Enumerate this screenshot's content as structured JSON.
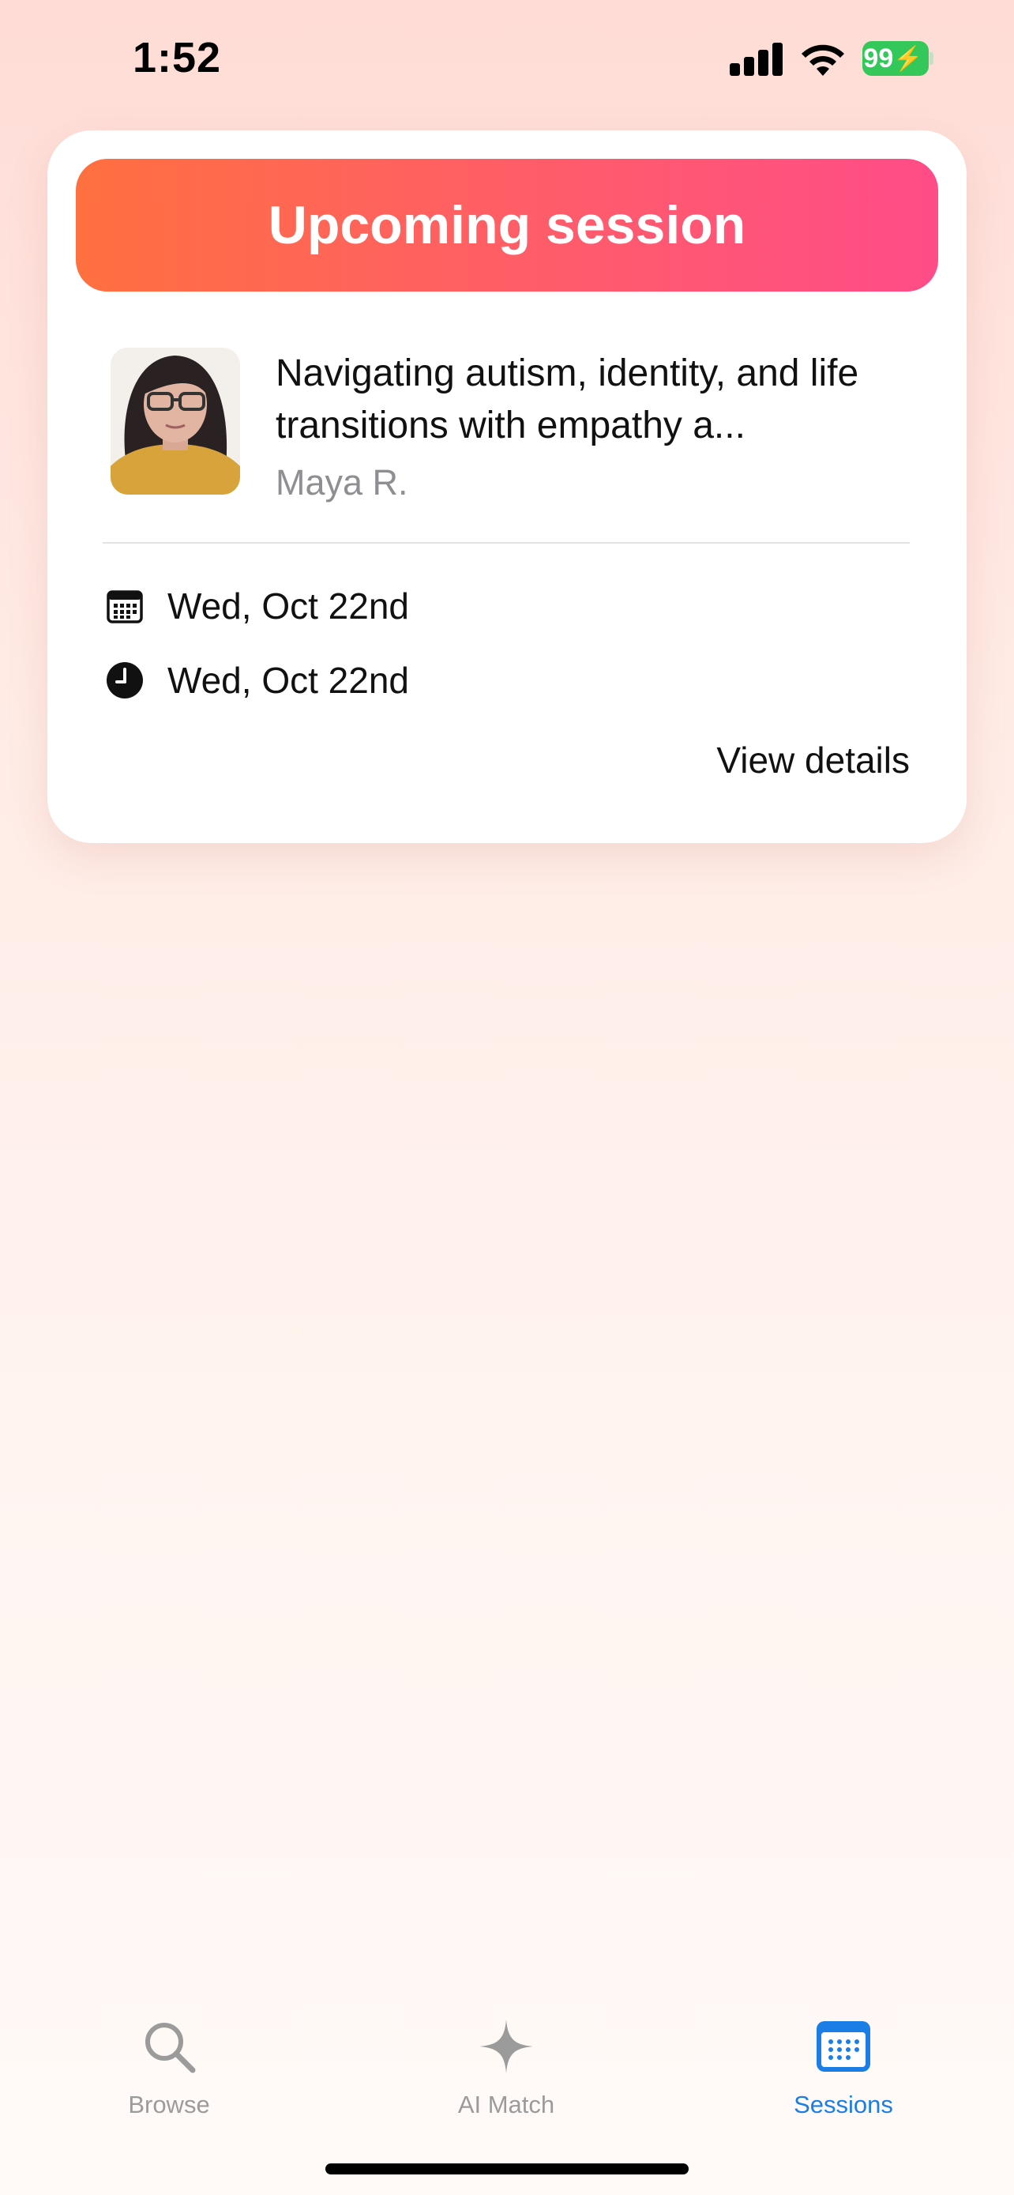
{
  "status_bar": {
    "time": "1:52",
    "battery": "99",
    "icons": [
      "signal-icon",
      "wifi-icon",
      "battery-charging-icon"
    ]
  },
  "card": {
    "header_title": "Upcoming session",
    "session_title": "Navigating autism, identity, and life transitions with empathy a...",
    "host_name": "Maya R.",
    "date_label": "Wed, Oct 22nd",
    "time_label": "Wed, Oct 22nd",
    "view_details": "View details",
    "header_gradient": [
      "#ff7040",
      "#ff4c88"
    ]
  },
  "tab_bar": {
    "tabs": [
      {
        "label": "Browse",
        "icon": "search-icon",
        "active": false
      },
      {
        "label": "AI Match",
        "icon": "sparkle-icon",
        "active": false
      },
      {
        "label": "Sessions",
        "icon": "calendar-icon",
        "active": true
      }
    ],
    "active_color": "#1a7ee6",
    "inactive_color": "#9b9b9b"
  }
}
